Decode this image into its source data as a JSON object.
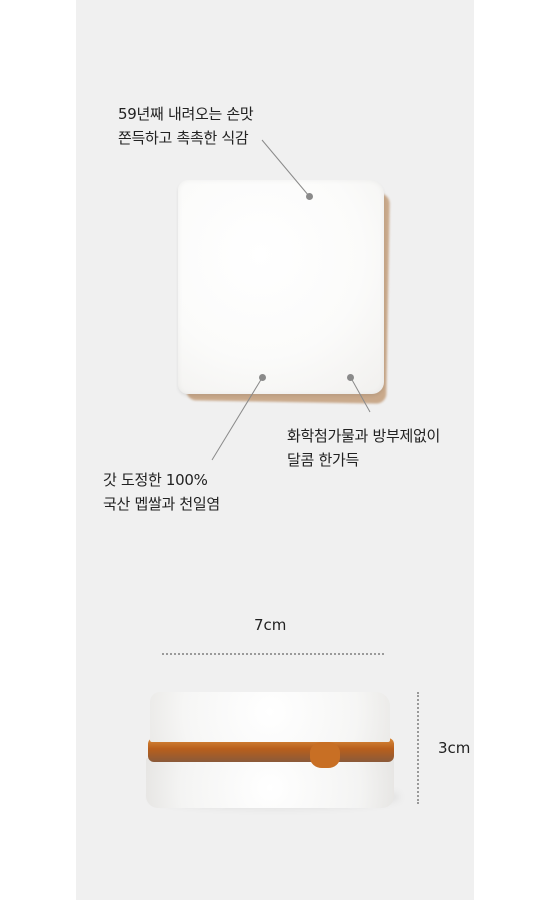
{
  "annotations": {
    "top_left": "59년째 내려오는 손맛\n쫀득하고 촉촉한 식감",
    "right": "화학첨가물과 방부제없이\n달콤 한가득",
    "bottom_left": "갓 도정한 100%\n국산 멥쌀과 천일염"
  },
  "dimensions": {
    "width_label": "7cm",
    "height_label": "3cm"
  }
}
